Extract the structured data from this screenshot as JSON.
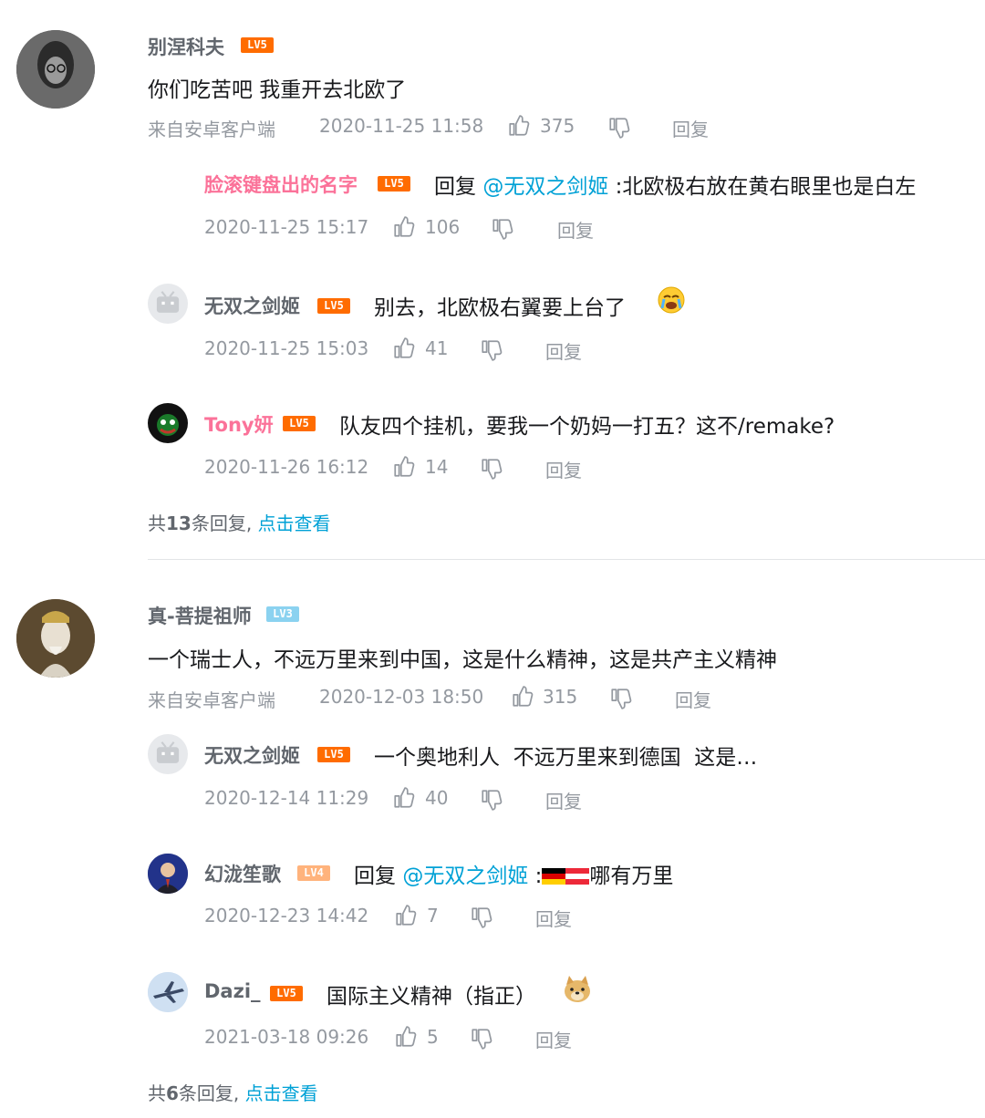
{
  "labels": {
    "from_android": "来自安卓客户端",
    "reply": "回复",
    "reply_prefix": "回复",
    "lv5": "LV5",
    "lv4": "LV4",
    "lv3": "LV3"
  },
  "threads": [
    {
      "author": "别涅科夫",
      "level": "LV5",
      "content": "你们吃苦吧 我重开去北欧了",
      "source": "来自安卓客户端",
      "time": "2020-11-25 11:58",
      "likes": "375",
      "replies": [
        {
          "author": "脸滚键盘出的名字",
          "level": "LV5",
          "reply_prefix": "回复",
          "mention": "@无双之剑姬",
          "content": ":北欧极右放在黄右眼里也是白左",
          "time": "2020-11-25 15:17",
          "likes": "106"
        },
        {
          "author": "无双之剑姬",
          "level": "LV5",
          "content": "别去，北欧极右翼要上台了",
          "emoji": "crying-face-emoji",
          "time": "2020-11-25 15:03",
          "likes": "41"
        },
        {
          "author": "Tony妍",
          "level": "LV5",
          "content": "队友四个挂机，要我一个奶妈一打五？这不/remake?",
          "time": "2020-11-26 16:12",
          "likes": "14"
        }
      ],
      "more_count_prefix": "共",
      "more_count": "13",
      "more_count_suffix": "条回复,",
      "more_link": "点击查看"
    },
    {
      "author": "真-菩提祖师",
      "level": "LV3",
      "content": "一个瑞士人，不远万里来到中国，这是什么精神，这是共产主义精神",
      "source": "来自安卓客户端",
      "time": "2020-12-03 18:50",
      "likes": "315",
      "replies": [
        {
          "author": "无双之剑姬",
          "level": "LV5",
          "content": "一个奥地利人  不远万里来到德国  这是…",
          "time": "2020-12-14 11:29",
          "likes": "40"
        },
        {
          "author": "幻泷笙歌",
          "level": "LV4",
          "reply_prefix": "回复",
          "mention": "@无双之剑姬",
          "content_prefix": ":",
          "content": "哪有万里",
          "flags": [
            "germany-flag-icon",
            "austria-flag-icon"
          ],
          "time": "2020-12-23 14:42",
          "likes": "7"
        },
        {
          "author": "Dazi_",
          "level": "LV5",
          "content": "国际主义精神（指正）",
          "emoji": "doge-emoji",
          "time": "2021-03-18 09:26",
          "likes": "5"
        }
      ],
      "more_count_prefix": "共",
      "more_count": "6",
      "more_count_suffix": "条回复,",
      "more_link": "点击查看"
    }
  ],
  "colors": {
    "vip_name": "#fb7299",
    "link": "#00a1d6",
    "meta": "#9499a0",
    "lv5": "#ff6c00",
    "lv4": "#ffb37c",
    "lv3": "#8bd2f0"
  }
}
